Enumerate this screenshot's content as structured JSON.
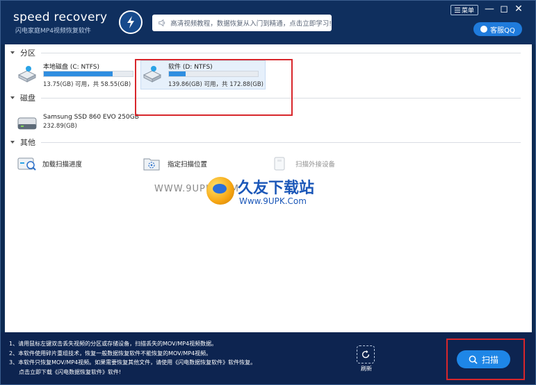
{
  "header": {
    "logo_title": "speed recovery",
    "logo_subtitle": "闪电家庭MP4视频恢复软件",
    "notice": "高清视频教程，数据恢复从入门到精通，点击立即学习!",
    "menu_label": "菜单",
    "min_glyph": "—",
    "max_glyph": "◻",
    "close_glyph": "✕",
    "qq_label": "客服QQ"
  },
  "sections": {
    "partition": "分区",
    "disk": "磁盘",
    "other": "其他"
  },
  "partitions": [
    {
      "name": "本地磁盘 (C: NTFS)",
      "size": "13.75(GB) 可用，共 58.55(GB)",
      "used_fraction": 0.77
    },
    {
      "name": "软件 (D: NTFS)",
      "size": "139.86(GB) 可用，共 172.88(GB)",
      "used_fraction": 0.19
    }
  ],
  "disks": [
    {
      "name": "Samsung SSD 860 EVO 250GB",
      "size": "232.89(GB)"
    }
  ],
  "others": [
    {
      "label": "加载扫描进度"
    },
    {
      "label": "指定扫描位置"
    },
    {
      "label": "扫描外接设备"
    }
  ],
  "watermark": {
    "left": "WWW.9UPK.COM",
    "title": "久友下载站",
    "url": "Www.9UPK.Com"
  },
  "footer": {
    "tips": [
      "1、请用鼠标左键双击丢失视频的分区或存储设备，扫描丢失的MOV/MP4视频数据。",
      "2、本软件使用碎片重组技术，恢复一般数据恢复软件不能恢复的MOV/MP4视频。",
      "3、本软件只恢复MOV/MP4视频。如果需要恢复其他文件，请使用《闪电数据恢复软件》软件恢复。",
      "点击立即下载《闪电数据恢复软件》软件!"
    ],
    "refresh_label": "刷新",
    "scan_label": "扫描"
  },
  "colors": {
    "accent": "#1e86e6",
    "highlight": "#d8262b",
    "header_bg": "#0f2f5e"
  }
}
